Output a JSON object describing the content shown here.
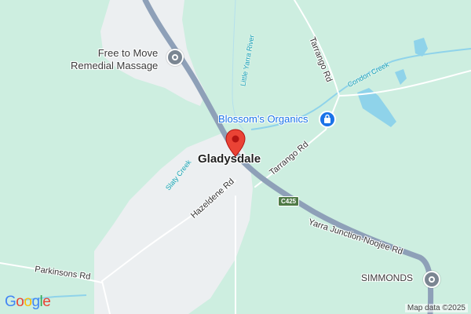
{
  "map": {
    "town": "Gladysdale",
    "places": [
      {
        "id": "remedial",
        "label_line1": "Free to Move",
        "label_line2": "Remedial Massage",
        "icon": "gray-place-icon"
      },
      {
        "id": "organics",
        "label": "Blossom's Organics",
        "icon": "shopping-bag-icon"
      },
      {
        "id": "simmonds",
        "label": "SIMMONDS",
        "icon": "gray-place-icon"
      }
    ],
    "roads": {
      "tarrango_north": "Tarrango Rd",
      "tarrango_south": "Tarrango Rd",
      "hazeldene": "Hazeldene Rd",
      "yarra_junction": "Yarra Junction-Noojee Rd",
      "parkinsons": "Parkinsons Rd"
    },
    "route_shield": "C425",
    "waterways": {
      "little_yarra": "Little Yarra River",
      "condon_creek": "Condon Creek",
      "slaty_creek": "Slaty Creek"
    },
    "colors": {
      "land": "#cdeee0",
      "urban": "#eceff1",
      "main_road": "#8ea0b8",
      "water": "#8fd3ea",
      "pin": "#ea4335",
      "place_gray": "#7b8692",
      "shop_blue": "#1a73e8"
    }
  },
  "branding": {
    "logo_letters": [
      "G",
      "o",
      "o",
      "g",
      "l",
      "e"
    ],
    "logo_colors": [
      "#4285f4",
      "#ea4335",
      "#fbbc05",
      "#4285f4",
      "#34a853",
      "#ea4335"
    ],
    "attribution": "Map data ©2025"
  }
}
